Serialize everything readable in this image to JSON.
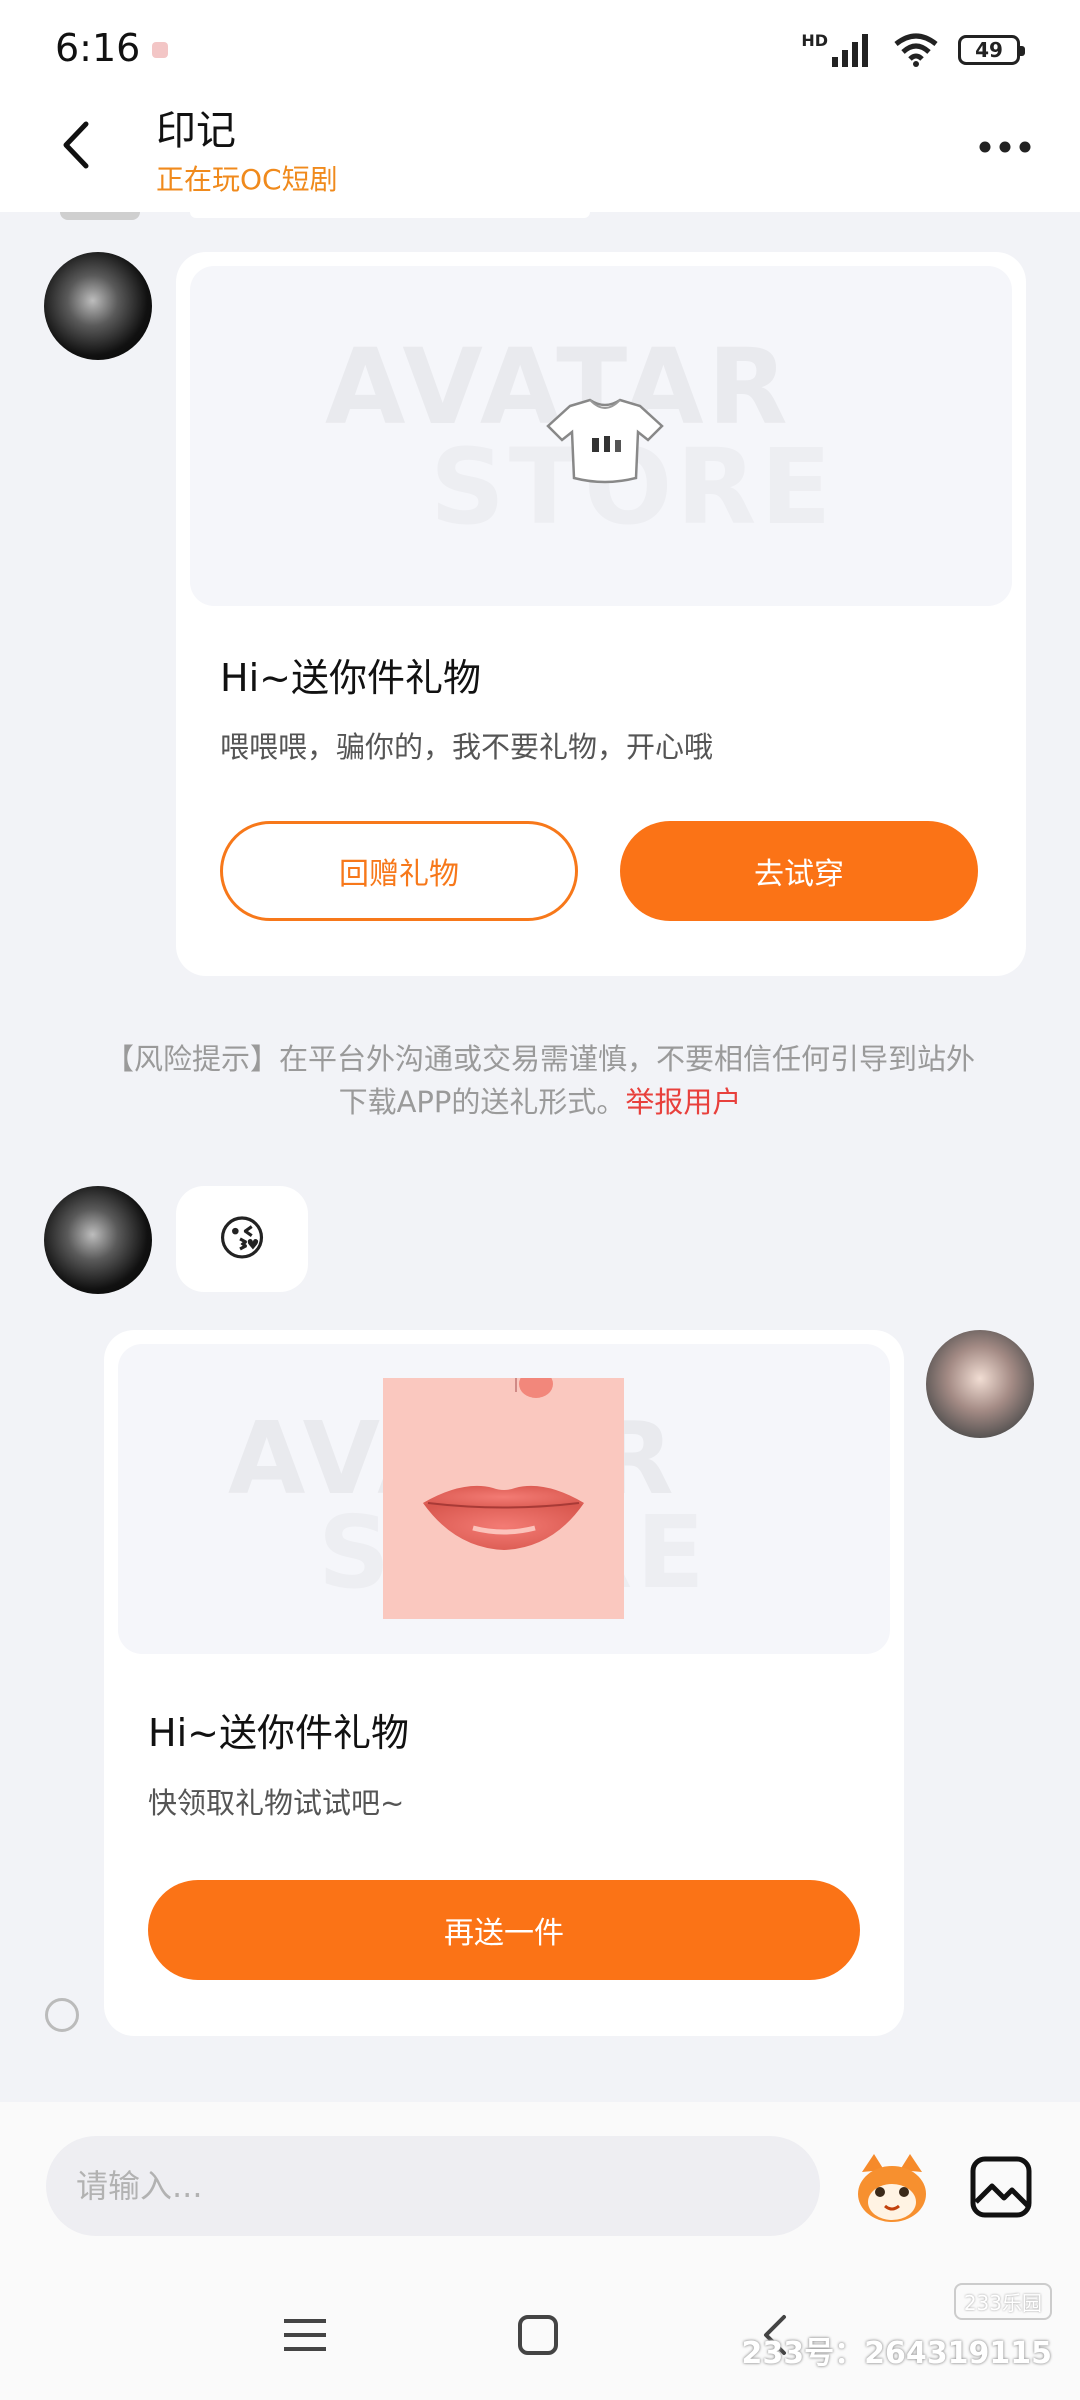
{
  "status_bar": {
    "time": "6:16",
    "network": "HD",
    "battery": "49"
  },
  "header": {
    "title": "印记",
    "subtitle": "正在玩OC短剧",
    "back_icon": "chevron-left-icon",
    "more_icon": "more-dots-icon"
  },
  "messages": {
    "gift_received": {
      "image_watermark": [
        "AVATAR",
        "STORE"
      ],
      "title": "Hi~送你件礼物",
      "text": "喂喂喂，骗你的，我不要礼物，开心哦",
      "return_button": "回赠礼物",
      "try_button": "去试穿"
    },
    "risk_notice": {
      "text": "【风险提示】在平台外沟通或交易需谨慎，不要相信任何引导到站外下载APP的送礼形式。",
      "link": "举报用户"
    },
    "emoji": "😘",
    "gift_sent": {
      "image_watermark": [
        "AVATAR",
        "STORE"
      ],
      "title": "Hi~送你件礼物",
      "text": "快领取礼物试试吧~",
      "send_again_button": "再送一件"
    }
  },
  "input_bar": {
    "placeholder": "请输入..."
  },
  "watermark": {
    "logo": "233乐园",
    "id_text": "233号：264319115"
  },
  "colors": {
    "accent": "#fb7316",
    "subtitle": "#f08a1c",
    "report_link": "#e8403c"
  }
}
